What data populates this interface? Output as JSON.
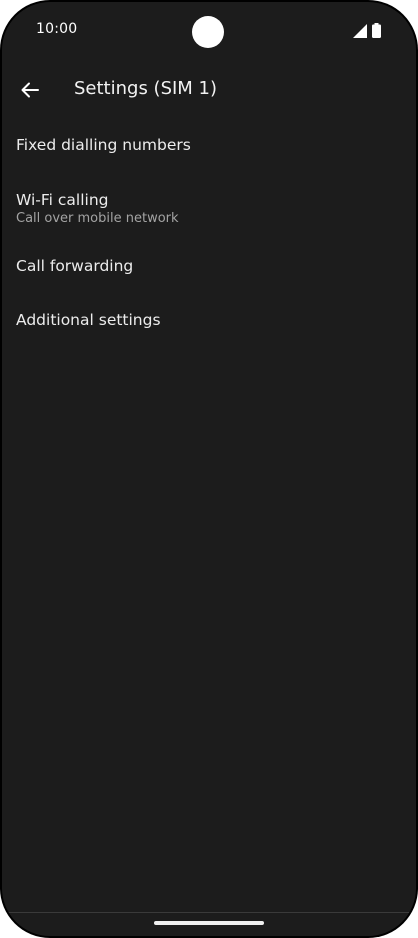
{
  "status_bar": {
    "time": "10:00",
    "icons": [
      "signal-icon",
      "battery-icon"
    ]
  },
  "app_bar": {
    "back_icon": "arrow-left-icon",
    "title": "Settings (SIM 1)"
  },
  "settings": {
    "items": [
      {
        "title": "Fixed dialling numbers",
        "summary": ""
      },
      {
        "title": "Wi-Fi calling",
        "summary": "Call over mobile network"
      },
      {
        "title": "Call forwarding",
        "summary": ""
      },
      {
        "title": "Additional settings",
        "summary": ""
      }
    ]
  },
  "colors": {
    "background": "#1c1c1c",
    "text_primary": "#ececec",
    "text_secondary": "#a3a3a3"
  }
}
